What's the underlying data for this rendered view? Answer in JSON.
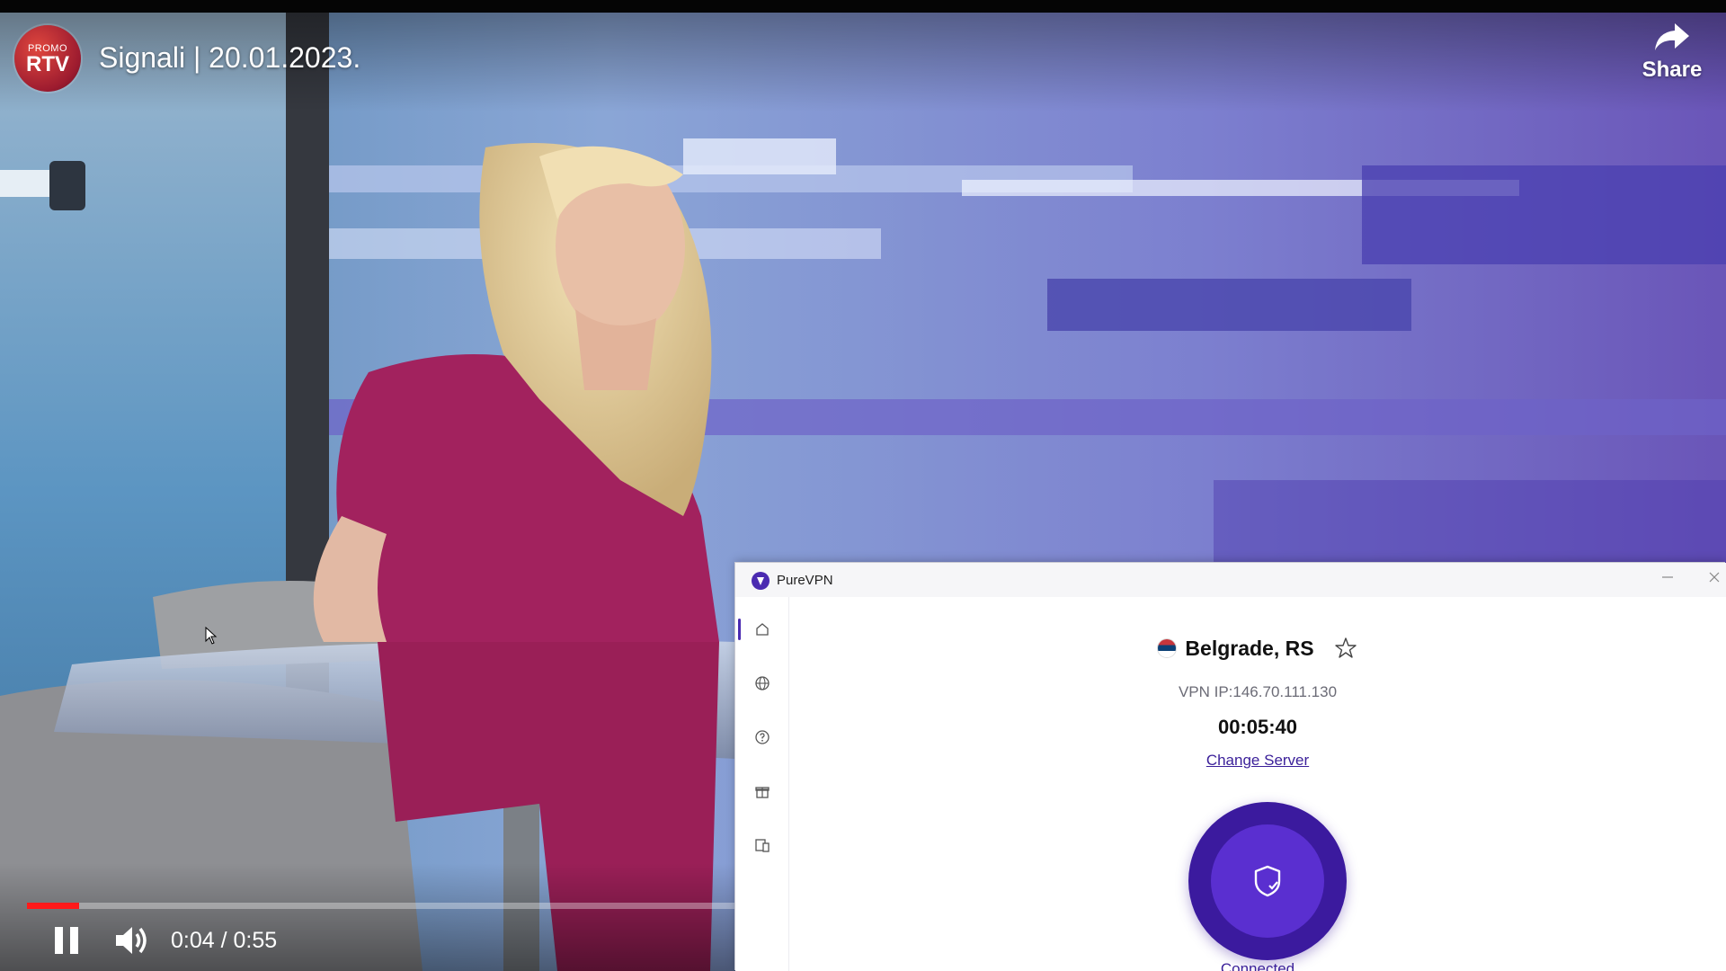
{
  "player": {
    "channel_logo": {
      "small": "PROMO",
      "big": "RTV"
    },
    "title": "Signali | 20.01.2023.",
    "share_label": "Share",
    "current_time": "0:04",
    "duration": "0:55",
    "time_display": "0:04 / 0:55",
    "progress": {
      "current_seconds": 4,
      "duration_seconds": 55
    },
    "icons": [
      "share-icon",
      "pause-icon",
      "volume-icon"
    ],
    "colors": {
      "progress": "#ff1a1a"
    }
  },
  "vpn": {
    "app_name": "PureVPN",
    "location": "Belgrade,  RS",
    "country_flag": "serbia-flag-icon",
    "ip": "VPN IP:146.70.111.130",
    "timer": "00:05:40",
    "change_server_label": "Change Server",
    "status": "Connected",
    "sidebar_icons": [
      "home-icon",
      "globe-icon",
      "help-icon",
      "gift-icon",
      "devices-icon"
    ],
    "colors": {
      "brand": "#3b1a9e",
      "brand_light": "#5a2fd0"
    }
  }
}
